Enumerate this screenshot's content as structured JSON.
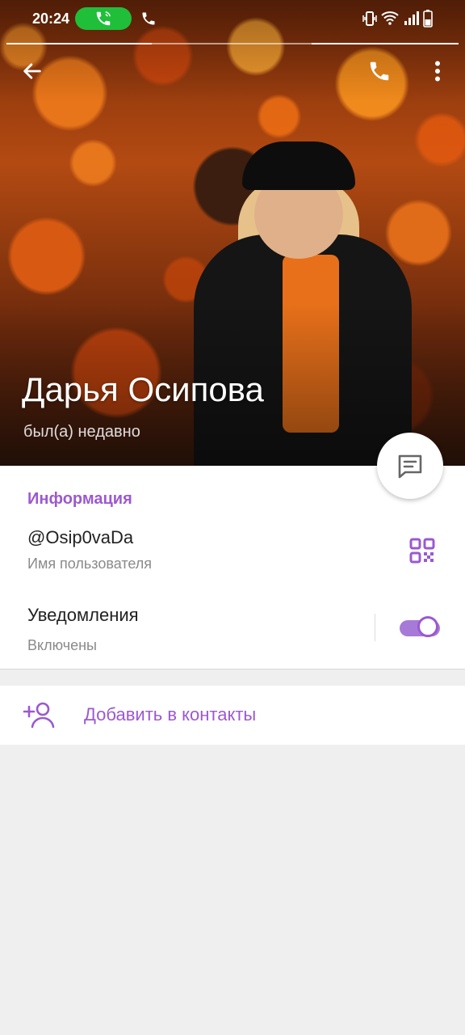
{
  "status_bar": {
    "time": "20:24"
  },
  "profile": {
    "name": "Дарья Осипова",
    "last_seen": "был(а) недавно"
  },
  "info": {
    "section_title": "Информация",
    "username": "@Osip0vaDa",
    "username_caption": "Имя пользователя",
    "notifications_label": "Уведомления",
    "notifications_state": "Включены",
    "notifications_enabled": true
  },
  "actions": {
    "add_contact": "Добавить в контакты"
  },
  "colors": {
    "accent": "#9b59d0",
    "call_pill": "#1fbf3a"
  }
}
